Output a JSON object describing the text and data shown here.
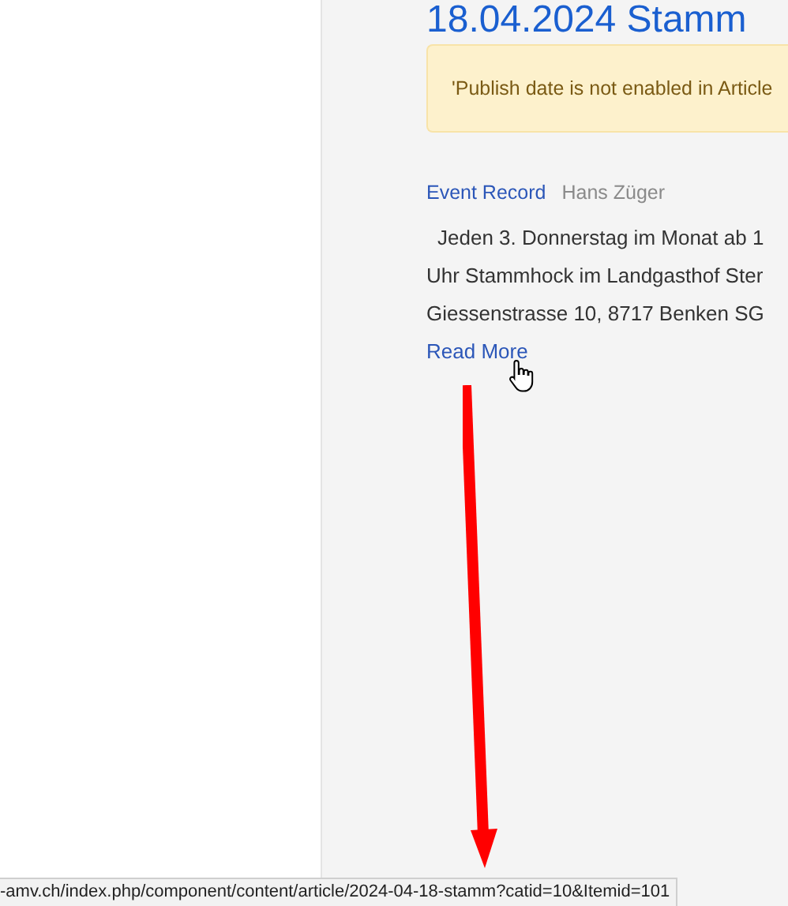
{
  "article": {
    "title": "18.04.2024 Stamm",
    "notice": "'Publish date is not enabled in Article",
    "category": "Event Record",
    "author": "Hans Züger",
    "intro_lines": [
      "Jeden 3. Donnerstag im Monat ab 1",
      "Uhr Stammhock im Landgasthof Ster",
      "Giessenstrasse 10, 8717 Benken  SG"
    ],
    "read_more": "Read More"
  },
  "status_bar": {
    "url": "-amv.ch/index.php/component/content/article/2024-04-18-stamm?catid=10&Itemid=101"
  }
}
